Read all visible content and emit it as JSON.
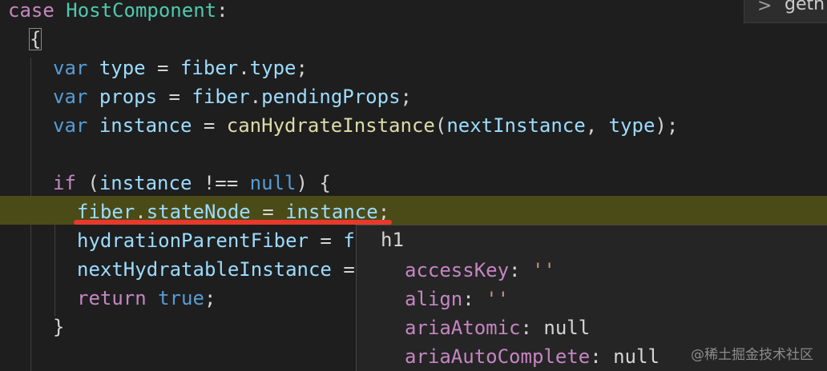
{
  "breadcrumb": {
    "separator": ">",
    "item": "geth"
  },
  "code": {
    "line1": {
      "kw": "case",
      "name": "HostComponent",
      "colon": ":"
    },
    "line2": {
      "brace": "{"
    },
    "line3": {
      "kw": "var",
      "name": "type",
      "eq": " = ",
      "obj": "fiber",
      "dot": ".",
      "prop": "type",
      "end": ";"
    },
    "line4": {
      "kw": "var",
      "name": "props",
      "eq": " = ",
      "obj": "fiber",
      "dot": ".",
      "prop": "pendingProps",
      "end": ";"
    },
    "line5": {
      "kw": "var",
      "name": "instance",
      "eq": " = ",
      "fn": "canHydrateInstance",
      "open": "(",
      "arg1": "nextInstance",
      "comma": ", ",
      "arg2": "type",
      "close": ");"
    },
    "line6": {
      "kw": "if",
      "open": " (",
      "name": "instance",
      "op": " !== ",
      "null": "null",
      "close": ") {"
    },
    "line7": {
      "obj": "fiber",
      "dot": ".",
      "prop": "stateNode",
      "eq": " = ",
      "value": "instance",
      "end": ";"
    },
    "line8": {
      "name": "hydrationParentFiber",
      "eq": " = ",
      "tail": "f"
    },
    "line9": {
      "name": "nextHydratableInstance",
      "eq": " ="
    },
    "line10": {
      "kw": "return",
      "value": "true",
      "end": ";"
    },
    "line11": {
      "brace": "}"
    }
  },
  "hover": {
    "title": "h1",
    "rows": [
      {
        "key": "accessKey",
        "sep": ": ",
        "value": "''"
      },
      {
        "key": "align",
        "sep": ": ",
        "value": "''"
      },
      {
        "key": "ariaAtomic",
        "sep": ": ",
        "value": "null"
      },
      {
        "key": "ariaAutoComplete",
        "sep": ": ",
        "value": "null"
      }
    ]
  },
  "watermark": "@稀土掘金技术社区",
  "colors": {
    "background": "#1e1e1e",
    "highlight_line": "#4b4b18",
    "squiggle": "#e8392b",
    "hover_bg": "#252526"
  }
}
